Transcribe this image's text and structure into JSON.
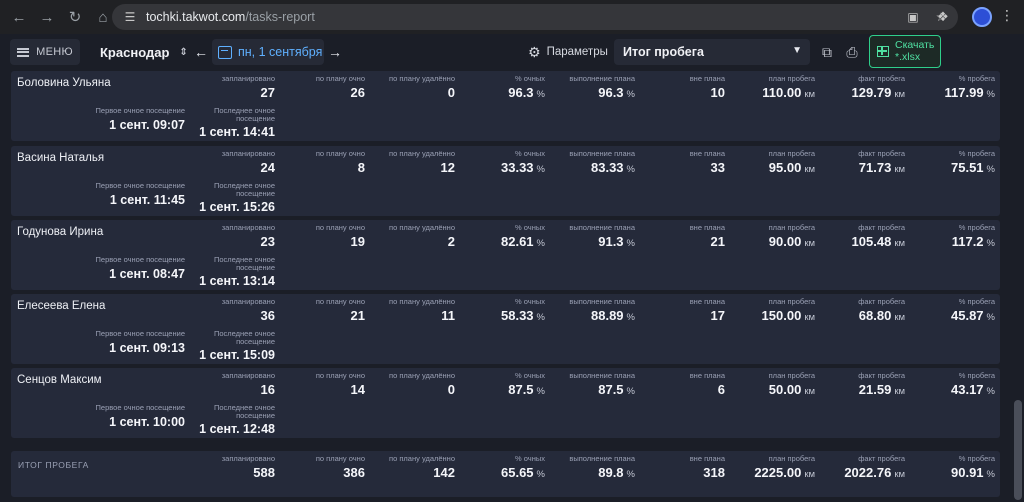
{
  "browser": {
    "url_host": "tochki.takwot.com",
    "url_path": "/tasks-report"
  },
  "header": {
    "menu_label": "МЕНЮ",
    "city": "Краснодар",
    "date": "пн, 1 сентября",
    "params_label": "Параметры",
    "report_select": "Итог пробега",
    "download_label_line1": "Скачать",
    "download_label_line2": "*.xlsx"
  },
  "labels": {
    "planned": "запланировано",
    "plan_onsite": "по плану очно",
    "plan_remote": "по плану удалённо",
    "pct_onsite": "% очных",
    "plan_exec": "выполнение плана",
    "out_of_plan": "вне плана",
    "plan_mileage": "план пробега",
    "fact_mileage": "факт пробега",
    "pct_mileage": "% пробега",
    "first_visit": "Первое очное посещение",
    "last_visit": "Последнее очное посещение",
    "total": "ИТОГ ПРОБЕГА",
    "unit_pct": "%",
    "unit_km": "км"
  },
  "rows": [
    {
      "name": "Боловина Ульяна",
      "planned": "27",
      "plan_onsite": "26",
      "plan_remote": "0",
      "pct_onsite": "96.3",
      "plan_exec": "96.3",
      "out_of_plan": "10",
      "plan_mileage": "110.00",
      "fact_mileage": "129.79",
      "pct_mileage": "117.99",
      "first_visit": "1 сент. 09:07",
      "last_visit": "1 сент. 14:41"
    },
    {
      "name": "Васина Наталья",
      "planned": "24",
      "plan_onsite": "8",
      "plan_remote": "12",
      "pct_onsite": "33.33",
      "plan_exec": "83.33",
      "out_of_plan": "33",
      "plan_mileage": "95.00",
      "fact_mileage": "71.73",
      "pct_mileage": "75.51",
      "first_visit": "1 сент. 11:45",
      "last_visit": "1 сент. 15:26"
    },
    {
      "name": "Годунова Ирина",
      "planned": "23",
      "plan_onsite": "19",
      "plan_remote": "2",
      "pct_onsite": "82.61",
      "plan_exec": "91.3",
      "out_of_plan": "21",
      "plan_mileage": "90.00",
      "fact_mileage": "105.48",
      "pct_mileage": "117.2",
      "first_visit": "1 сент. 08:47",
      "last_visit": "1 сент. 13:14"
    },
    {
      "name": "Елесеева Елена",
      "planned": "36",
      "plan_onsite": "21",
      "plan_remote": "11",
      "pct_onsite": "58.33",
      "plan_exec": "88.89",
      "out_of_plan": "17",
      "plan_mileage": "150.00",
      "fact_mileage": "68.80",
      "pct_mileage": "45.87",
      "first_visit": "1 сент. 09:13",
      "last_visit": "1 сент. 15:09"
    },
    {
      "name": "Сенцов Максим",
      "planned": "16",
      "plan_onsite": "14",
      "plan_remote": "0",
      "pct_onsite": "87.5",
      "plan_exec": "87.5",
      "out_of_plan": "6",
      "plan_mileage": "50.00",
      "fact_mileage": "21.59",
      "pct_mileage": "43.17",
      "first_visit": "1 сент. 10:00",
      "last_visit": "1 сент. 12:48"
    }
  ],
  "total": {
    "planned": "588",
    "plan_onsite": "386",
    "plan_remote": "142",
    "pct_onsite": "65.65",
    "plan_exec": "89.8",
    "out_of_plan": "318",
    "plan_mileage": "2225.00",
    "fact_mileage": "2022.76",
    "pct_mileage": "90.91"
  },
  "colors": {
    "background": "#1b1e27",
    "card": "#252a3a",
    "accent_date": "#5fb0ff",
    "accent_download": "#4fe0a2"
  }
}
